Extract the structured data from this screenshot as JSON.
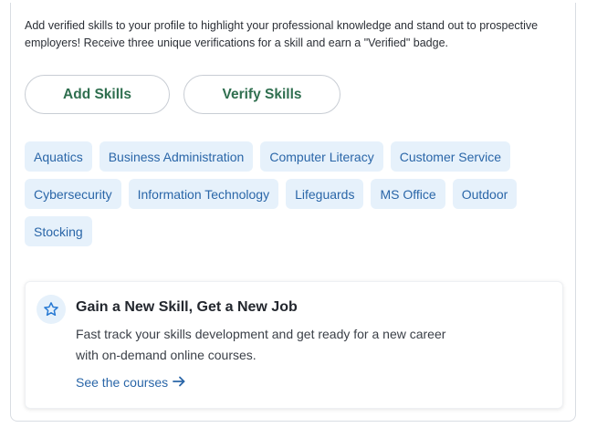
{
  "intro": {
    "text": "Add verified skills to your profile to highlight your professional knowledge and stand out to prospective employers! Receive three unique verifications for a skill and earn a \"Verified\" badge."
  },
  "actions": {
    "add_skills_label": "Add Skills",
    "verify_skills_label": "Verify Skills"
  },
  "skills": [
    "Aquatics",
    "Business Administration",
    "Computer Literacy",
    "Customer Service",
    "Cybersecurity",
    "Information Technology",
    "Lifeguards",
    "MS Office",
    "Outdoor",
    "Stocking"
  ],
  "promo": {
    "icon": "star-icon",
    "title": "Gain a New Skill, Get a New Job",
    "body": "Fast track your skills development and get ready for a new career with on-demand online courses.",
    "link_label": "See the courses",
    "link_icon": "arrow-right-icon"
  },
  "colors": {
    "button_text": "#2f6f4f",
    "chip_bg": "#e6f1fb",
    "chip_text": "#2a66a8",
    "link": "#2a66a8"
  }
}
